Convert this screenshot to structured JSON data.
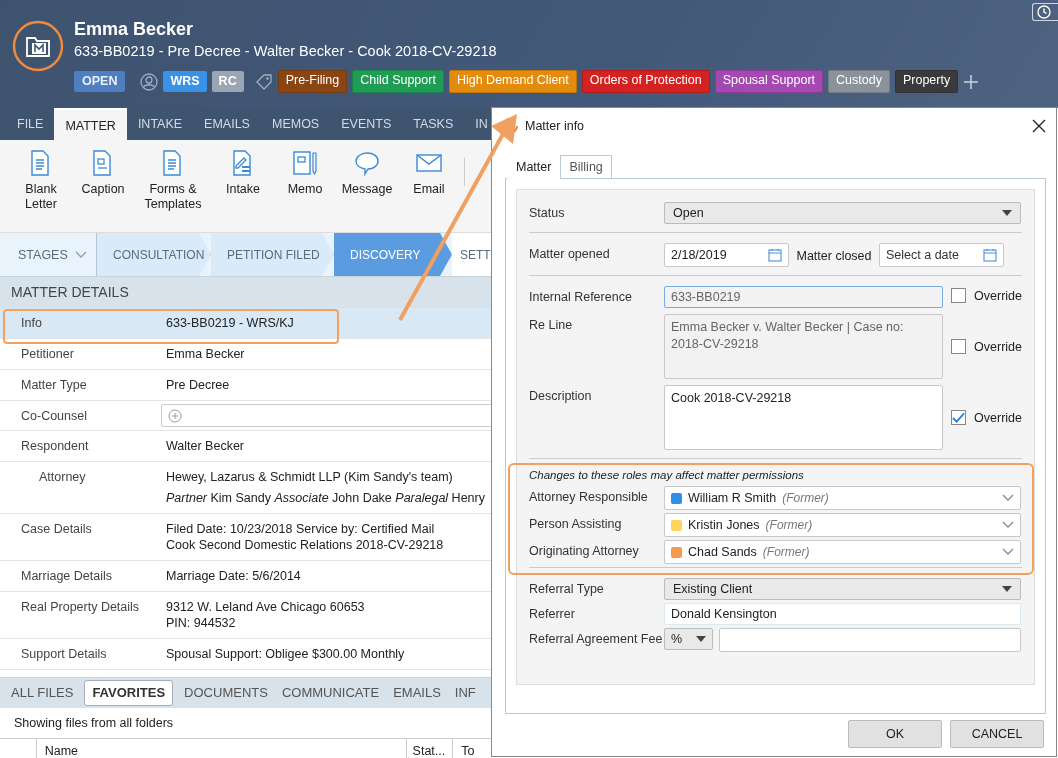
{
  "header": {
    "name": "Emma Becker",
    "subtitle": "633-BB0219 - Pre Decree - Walter Becker - Cook 2018-CV-29218",
    "status": "OPEN",
    "people": [
      "WRS",
      "RC"
    ],
    "tags": [
      {
        "label": "Pre-Filing",
        "color": "#8b4513"
      },
      {
        "label": "Child Support",
        "color": "#1f9d55"
      },
      {
        "label": "High Demand Client",
        "color": "#e28b0c"
      },
      {
        "label": "Orders of Protection",
        "color": "#d42222"
      },
      {
        "label": "Spousal Support",
        "color": "#a448b2"
      },
      {
        "label": "Custody",
        "color": "#8b929b"
      },
      {
        "label": "Property",
        "color": "#3a3a3c"
      }
    ]
  },
  "ribbon_tabs": [
    {
      "label": "FILE",
      "selected": false
    },
    {
      "label": "MATTER",
      "selected": true
    },
    {
      "label": "INTAKE",
      "selected": false
    },
    {
      "label": "EMAILS",
      "selected": false
    },
    {
      "label": "MEMOS",
      "selected": false
    },
    {
      "label": "EVENTS",
      "selected": false
    },
    {
      "label": "TASKS",
      "selected": false
    },
    {
      "label": "IN",
      "selected": false
    }
  ],
  "ribbon_buttons": [
    {
      "label": "Blank Letter",
      "kind": "letter"
    },
    {
      "label": "Caption",
      "kind": "caption"
    },
    {
      "label": "Forms & Templates",
      "kind": "letter"
    },
    {
      "label": "Intake",
      "kind": "intake"
    },
    {
      "label": "Memo",
      "kind": "memo"
    },
    {
      "label": "Message",
      "kind": "message"
    },
    {
      "label": "Email",
      "kind": "email"
    }
  ],
  "stages": {
    "menu": "STAGES",
    "items": [
      {
        "label": "CONSULTATION",
        "selected": false
      },
      {
        "label": "PETITION FILED",
        "selected": false
      },
      {
        "label": "DISCOVERY",
        "selected": true
      },
      {
        "label": "SETT",
        "selected": false
      }
    ]
  },
  "details": {
    "title": "MATTER DETAILS",
    "rows": [
      {
        "label": "Info",
        "lines": [
          "633-BB0219 - WRS/KJ"
        ],
        "selected": true
      },
      {
        "label": "Petitioner",
        "lines": [
          "Emma Becker"
        ],
        "selected": false
      },
      {
        "label": "Matter Type",
        "lines": [
          "Pre Decree"
        ],
        "selected": false
      },
      {
        "label": "Co-Counsel",
        "kind": "field",
        "selected": false
      },
      {
        "label": "Respondent",
        "lines": [
          "Walter Becker"
        ],
        "selected": false,
        "children": [
          {
            "label": "Attorney",
            "lines": [
              "Hewey, Lazarus & Schmidt LLP (Kim Sandy's team)",
              "*Partner* Kim Sandy *Associate* John Dake *Paralegal* Henry"
            ],
            "selected": false
          }
        ]
      },
      {
        "label": "Case Details",
        "lines": [
          "Filed Date: 10/23/2018  Service by: Certified Mail",
          "Cook Second Domestic Relations 2018-CV-29218"
        ],
        "selected": false
      },
      {
        "label": "Marriage Details",
        "lines": [
          "Marriage Date: 5/6/2014"
        ],
        "selected": false
      },
      {
        "label": "Real Property Details",
        "lines": [
          "9312 W. Leland Ave Chicago 60653",
          "PIN: 944532"
        ],
        "selected": false
      },
      {
        "label": "Support Details",
        "lines": [
          "Spousal Support: Obligee $300.00 Monthly"
        ],
        "selected": false
      }
    ]
  },
  "file_tabs": [
    {
      "label": "ALL FILES",
      "selected": false
    },
    {
      "label": "FAVORITES",
      "selected": true
    },
    {
      "label": "DOCUMENTS",
      "selected": false
    },
    {
      "label": "COMMUNICATE",
      "selected": false
    },
    {
      "label": "EMAILS",
      "selected": false
    },
    {
      "label": "INF",
      "selected": false
    }
  ],
  "files_note": "Showing files from all folders",
  "table": {
    "columns": [
      "Name",
      "Stat...",
      "To"
    ]
  },
  "dialog": {
    "title": "Matter info",
    "tabs": [
      {
        "label": "Matter",
        "selected": true
      },
      {
        "label": "Billing",
        "selected": false
      }
    ],
    "status": {
      "label": "Status",
      "value": "Open"
    },
    "opened": {
      "label": "Matter opened",
      "value": "2/18/2019"
    },
    "closed": {
      "label": "Matter closed",
      "placeholder": "Select a date"
    },
    "internal_reference": {
      "label": "Internal Reference",
      "value": "633-BB0219",
      "override_label": "Override",
      "override": false
    },
    "re_line": {
      "label": "Re Line",
      "value": "Emma Becker v. Walter Becker | Case no: 2018-CV-29218",
      "override_label": "Override",
      "override": false
    },
    "description": {
      "label": "Description",
      "value": "Cook 2018-CV-29218",
      "override_label": "Override",
      "override": true
    },
    "roles_note": "Changes to these roles may affect matter permissions",
    "roles": [
      {
        "label": "Attorney Responsible",
        "name": "William R Smith",
        "note": "(Former)",
        "color": "#2f8ee6"
      },
      {
        "label": "Person Assisting",
        "name": "Kristin Jones",
        "note": "(Former)",
        "color": "#fcd55a"
      },
      {
        "label": "Originating Attorney",
        "name": "Chad Sands",
        "note": "(Former)",
        "color": "#f59a4e"
      }
    ],
    "referral_type": {
      "label": "Referral Type",
      "value": "Existing Client"
    },
    "referrer": {
      "label": "Referrer",
      "value": "Donald Kensington"
    },
    "fee": {
      "label": "Referral Agreement Fee",
      "unit": "%"
    },
    "buttons": [
      "OK",
      "CANCEL"
    ]
  }
}
